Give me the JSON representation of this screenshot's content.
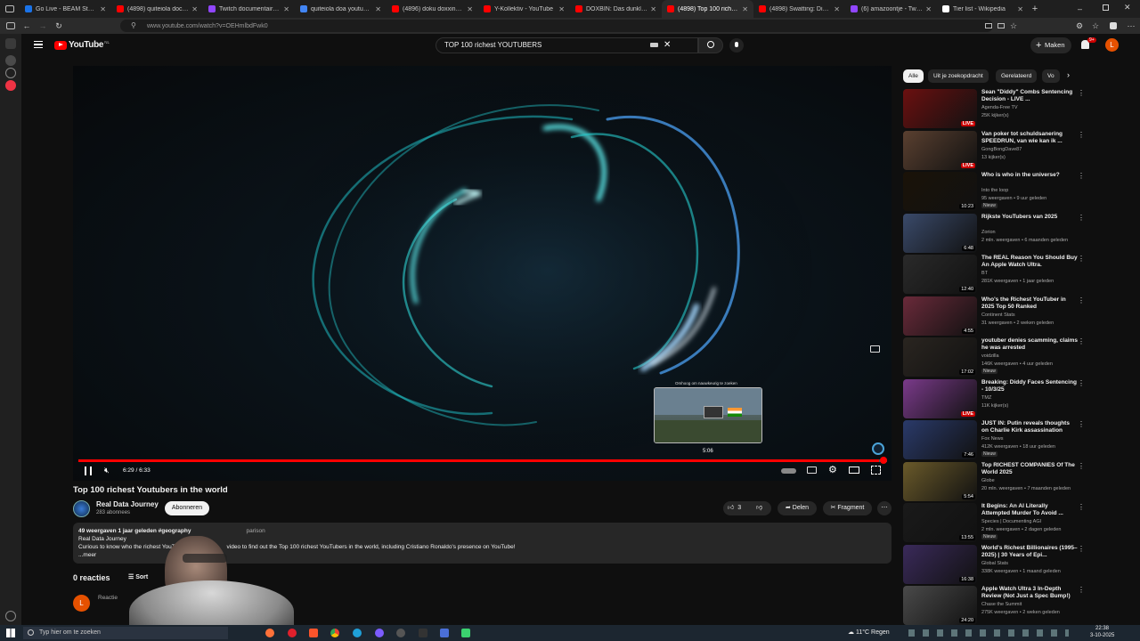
{
  "browser": {
    "tabs": [
      {
        "title": "Go Live - BEAM Studio",
        "color": "#1a73e8"
      },
      {
        "title": "(4898) quiteiola doc - YouTube",
        "color": "#ff0000"
      },
      {
        "title": "Twitch documentaire zoeke",
        "color": "#9146ff"
      },
      {
        "title": "quiteiola doa youtube deuts",
        "color": "#4285f4"
      },
      {
        "title": "(4896) doku doxxing deutsc",
        "color": "#ff0000"
      },
      {
        "title": "Y-Kollektiv - YouTube",
        "color": "#ff0000"
      },
      {
        "title": "DOXBIN: Das dunkle W",
        "color": "#ff0000"
      },
      {
        "title": "(4898) Top 100 richest Yout",
        "color": "#ff0000"
      },
      {
        "title": "(4898) Swatting: Die Polizei",
        "color": "#ff0000"
      },
      {
        "title": "(6) amazoontje - Twitch",
        "color": "#9146ff"
      },
      {
        "title": "Tier list - Wikipedia",
        "color": "#ffffff"
      }
    ],
    "active_tab": 7,
    "url": "www.youtube.com/watch?v=OEHmlbdFwk0"
  },
  "header": {
    "logo_text": "YouTube",
    "logo_region": "NL",
    "search_value": "TOP 100 richest YOUTUBERS",
    "create_label": "Maken",
    "notif_count": "9+",
    "avatar_letter": "L"
  },
  "player": {
    "time": "6:29 / 6:33",
    "hover_time": "5:06",
    "preview_caption": "Omhoog om nauwkeurig te zoeken",
    "progress": 0.99
  },
  "video": {
    "title": "Top 100 richest Youtubers in the world",
    "channel": "Real Data Journey",
    "subscribers": "283 abonnees",
    "subscribe_label": "Abonneren",
    "likes": "3",
    "share_label": "Delen",
    "clip_label": "Fragment",
    "desc_meta": "49 weergaven  1 jaar geleden  #geography",
    "desc_tag2": "parison",
    "desc_line1": "Real Data Journey",
    "desc_line2_a": "Curious to know who the richest YouTuber",
    "desc_line2_b": "video to find out the Top 100 richest YouTubers in the world, including Cristiano Ronaldo's presence on YouTube!",
    "desc_more": "...meer",
    "comments_label": "0 reacties",
    "sort_label": "Sort",
    "comment_placeholder": "Reactie",
    "comment_avatar": "L"
  },
  "chips": [
    "Alle",
    "Uit je zoekopdracht",
    "Gerelateerd",
    "Vo"
  ],
  "recommendations": [
    {
      "title": "Sean \"Diddy\" Combs Sentencing Decision - LIVE ...",
      "channel": "Agenda-Free TV",
      "meta": "25K kijker(s)",
      "badge": "LIVE",
      "new": "",
      "thumb": "#6b1010"
    },
    {
      "title": "Van poker tot schuldsanering SPEEDRUN, van wie kan ik ...",
      "channel": "GongBongDave87",
      "meta": "13 kijker(s)",
      "badge": "LIVE",
      "new": "",
      "thumb": "#5a4030"
    },
    {
      "title": "Who is who in the universe?",
      "channel": "Into the loop",
      "meta": "95 weergaven • 9 uur geleden",
      "badge": "10:23",
      "new": "Nieuw",
      "thumb": "#1a1208"
    },
    {
      "title": "Rijkste YouTubers van 2025",
      "channel": "Zorion",
      "meta": "2 mln. weergaven • 6 maanden geleden",
      "badge": "6:48",
      "new": "",
      "thumb": "#3a4a6a"
    },
    {
      "title": "The REAL Reason You Should Buy An Apple Watch Ultra.",
      "channel": "BT",
      "meta": "281K weergaven • 1 jaar geleden",
      "badge": "12:40",
      "new": "",
      "thumb": "#2a2a2a"
    },
    {
      "title": "Who's the Richest YouTuber in 2025 Top 50 Ranked",
      "channel": "Continent Stats",
      "meta": "31 weergaven • 2 weken geleden",
      "badge": "4:55",
      "new": "",
      "thumb": "#6a2a3a"
    },
    {
      "title": "youtuber denies scamming, claims he was arrested",
      "channel": "voidzilla",
      "meta": "146K weergaven • 4 uur geleden",
      "badge": "17:02",
      "new": "Nieuw",
      "thumb": "#2a2520"
    },
    {
      "title": "Breaking: Diddy Faces Sentencing - 10/3/25",
      "channel": "TMZ",
      "meta": "11K kijker(s)",
      "badge": "LIVE",
      "new": "",
      "thumb": "#7a3a8a"
    },
    {
      "title": "JUST IN: Putin reveals thoughts on Charlie Kirk assassination",
      "channel": "Fox News",
      "meta": "412K weergaven • 18 uur geleden",
      "badge": "7:46",
      "new": "Nieuw",
      "thumb": "#2a3a6a"
    },
    {
      "title": "Top RICHEST COMPANIES Of The World 2025",
      "channel": "Globe",
      "meta": "20 mln. weergaven • 7 maanden geleden",
      "badge": "5:54",
      "new": "",
      "thumb": "#6a5a2a"
    },
    {
      "title": "It Begins: An AI Literally Attempted Murder To Avoid ...",
      "channel": "Species | Documenting AGI",
      "meta": "2 mln. weergaven • 2 dagen geleden",
      "badge": "13:55",
      "new": "Nieuw",
      "thumb": "#1a1a1a"
    },
    {
      "title": "World's Richest Billionaires (1995–2025) | 30 Years of Epi...",
      "channel": "Global Stats",
      "meta": "338K weergaven • 1 maand geleden",
      "badge": "16:38",
      "new": "",
      "thumb": "#3a2a5a"
    },
    {
      "title": "Apple Watch Ultra 3 In-Depth Review (Not Just a Spec Bump!)",
      "channel": "Chase the Summit",
      "meta": "275K weergaven • 2 weken geleden",
      "badge": "24:20",
      "new": "",
      "thumb": "#4a4a4a"
    }
  ],
  "taskbar": {
    "search_placeholder": "Typ hier om te zoeken",
    "weather": "11°C  Regen",
    "time": "22:38",
    "date": "3-10-2025"
  }
}
